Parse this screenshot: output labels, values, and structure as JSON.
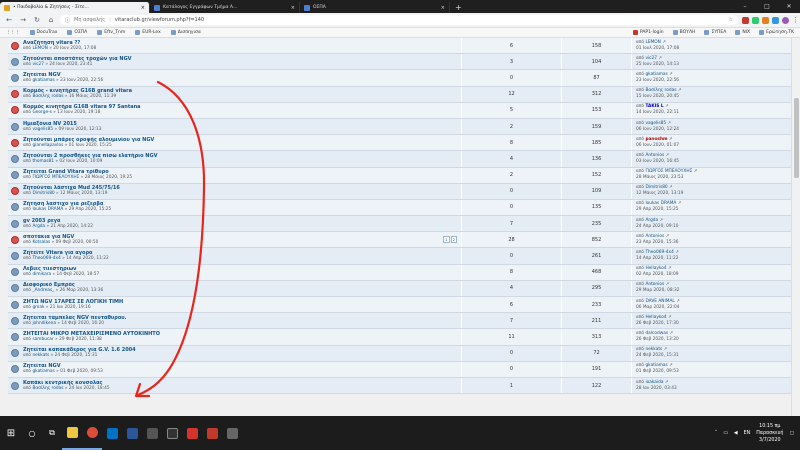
{
  "tabs": [
    {
      "label": "• Παιδοβολία & Ζητήσεις - Σίτε..."
    },
    {
      "label": "Κατάλογος Εγγράφων Τμήμα Α..."
    },
    {
      "label": "ΟΣΠΑ"
    }
  ],
  "address": {
    "security": "Μη ασφαλής",
    "url": "vitaraclub.gr/viewforum.php?f=140"
  },
  "bookmarks": [
    "DocuTrax",
    "ΟΣΠΑ",
    "Eftv_Tnm",
    "EUR-Lex",
    "Δισπηγισα"
  ],
  "bookmarks_right": [
    "PAP1-login",
    "ΒΟΥΛΗ",
    "ΣΥΠΕΑ",
    "NIX",
    "Eρώτηση.TK"
  ],
  "topics": [
    {
      "title": "Αναζήτηση vitara ??",
      "meta_prefix": "από",
      "author": "LEMON",
      "date": "» 20 Ιουν 2020, 17:08",
      "hot": true,
      "replies": "6",
      "views": "158",
      "last_author": "LEMON",
      "last_date": "01 Ιουλ 2020, 17:08"
    },
    {
      "title": "Ζητούνται αποστάτες τροχών για NGV",
      "meta_prefix": "από",
      "author": "vic27",
      "date": "» 24 Ιουν 2020, 23:41",
      "hot": false,
      "replies": "3",
      "views": "104",
      "last_author": "vic27",
      "last_date": "25 Ιουν 2020, 14:13"
    },
    {
      "title": "Ζητείται NGV",
      "meta_prefix": "από",
      "author": "gkatiamas",
      "date": "» 23 Ιουν 2020, 22:56",
      "hot": false,
      "replies": "0",
      "views": "87",
      "last_author": "gkatiamas",
      "last_date": "23 Ιουν 2020, 22:56"
    },
    {
      "title": "Κορμός - κινητήρας G16B grand vitara",
      "meta_prefix": "από",
      "author": "Βασίλης rodas",
      "date": "» 16 Μάιος 2020, 11:39",
      "hot": true,
      "replies": "12",
      "views": "312",
      "last_author": "Βασίλης rodas",
      "last_date": "15 Ιουν 2020, 20:45"
    },
    {
      "title": "Κορμός κινητήρα G16B vitara 97 Santana",
      "meta_prefix": "από",
      "author": "George-s",
      "date": "» 13 Ιουν 2020, 19:18",
      "hot": true,
      "replies": "5",
      "views": "153",
      "last_author": "TAKIS L",
      "last_date": "14 Ιουν 2020, 22:11",
      "last_blue": true
    },
    {
      "title": "Ημιαξόνια NV 2015",
      "meta_prefix": "από",
      "author": "vagelis85",
      "date": "» 09 Ιουν 2020, 12:13",
      "hot": false,
      "replies": "2",
      "views": "159",
      "last_author": "vagelis85",
      "last_date": "06 Ιουν 2020, 12:24"
    },
    {
      "title": "Ζητούνται μπάρες οροφής αλουμινίου για NGV",
      "meta_prefix": "από",
      "author": "gianellapavlos",
      "date": "» 01 Ιουν 2020, 15:25",
      "hot": true,
      "replies": "8",
      "views": "185",
      "last_author": "panoshm",
      "last_date": "06 Ιουν 2020, 01:07",
      "last_red": true
    },
    {
      "title": "Ζητούνται 2 προσθήκες για πίσω ελατήριο NGV",
      "meta_prefix": "από",
      "author": "thomas81",
      "date": "» 02 Ιουν 2020, 10:09",
      "hot": false,
      "replies": "4",
      "views": "136",
      "last_author": "Antonios",
      "last_date": "03 Ιουν 2020, 16:45"
    },
    {
      "title": "Ζητείται Grand Vitara τρίθυρο",
      "meta_prefix": "από",
      "author": "ΓΙΩΡΓΟΣ ΜΠΕΛΟΥΧΗΣ",
      "date": "» 28 Μάιος 2020, 19:25",
      "hot": false,
      "replies": "2",
      "views": "152",
      "last_author": "ΓΙΩΡΓΟΣ ΜΠΕΛΟΥΧΗΣ",
      "last_date": "28 Μάιος 2020, 23:53"
    },
    {
      "title": "Ζητούνται λάστιχα Mud 245/75/16",
      "meta_prefix": "από",
      "author": "Dimitris80",
      "date": "» 12 Μάιος 2020, 13:19",
      "hot": true,
      "replies": "0",
      "views": "109",
      "last_author": "Dimitris80",
      "last_date": "12 Μάιος 2020, 13:19"
    },
    {
      "title": "Ζήτηση λαστιχο για ρεζερβα",
      "meta_prefix": "από",
      "author": "loukas DRAMA",
      "date": "» 29 Απρ 2020, 15:25",
      "hot": false,
      "replies": "0",
      "views": "135",
      "last_author": "loukas DRAMA",
      "last_date": "29 Απρ 2020, 15:25"
    },
    {
      "title": "gv 2003 ρεγα",
      "meta_prefix": "από",
      "author": "Argda",
      "date": "» 21 Απρ 2020, 14:22",
      "hot": false,
      "replies": "7",
      "views": "235",
      "last_author": "Argda",
      "last_date": "24 Απρ 2020, 09:10"
    },
    {
      "title": "σποτακια για NGV",
      "meta_prefix": "από",
      "author": "Kotsalas",
      "date": "» 09 Φεβ 2020, 00:50",
      "hot": true,
      "replies": "28",
      "views": "852",
      "last_author": "Antonios",
      "last_date": "23 Απρ 2020, 15:36",
      "pages": [
        "1",
        "2"
      ]
    },
    {
      "title": "Ζητείτε Vitara για αγορα",
      "meta_prefix": "από",
      "author": "Theo069-4x4",
      "date": "» 14 Απρ 2020, 11:22",
      "hot": false,
      "replies": "0",
      "views": "261",
      "last_author": "Theo069-4x4",
      "last_date": "14 Απρ 2020, 11:22"
    },
    {
      "title": "Λεβιες τιιεστηριων",
      "meta_prefix": "από",
      "author": "dimikara",
      "date": "» 14 Φεβ 2020, 18:57",
      "hot": false,
      "replies": "8",
      "views": "468",
      "last_author": "Hellayko4",
      "last_date": "02 Απρ 2020, 18:09"
    },
    {
      "title": "Διαφορικό Εμπρός",
      "meta_prefix": "από",
      "author": "_Andreas_",
      "date": "» 26 Μαρ 2020, 13:36",
      "hot": false,
      "replies": "4",
      "views": "295",
      "last_author": "Antonios",
      "last_date": "29 Μαρ 2020, 08:32"
    },
    {
      "title": "ΖΗΤΩ NGV 17ΑΡΕΣ ΣΕ ΛΟΓΙΚΗ ΤΙΜΗ",
      "meta_prefix": "από",
      "author": "gmak",
      "date": "» 21 Ιαν 2020, 19:16",
      "hot": false,
      "replies": "6",
      "views": "233",
      "last_author": "DAVE ANIMAL",
      "last_date": "06 Μαρ 2020, 22:04"
    },
    {
      "title": "Ζητειται ταμπελας NGV πενταθυρου.",
      "meta_prefix": "από",
      "author": "johndikena",
      "date": "» 14 Φεβ 2020, 16:20",
      "hot": false,
      "replies": "7",
      "views": "211",
      "last_author": "Hellayko4",
      "last_date": "26 Φεβ 2020, 17:30"
    },
    {
      "title": "ΖΗΤΕΙΤΑΙ ΜΙΚΡΟ ΜΕΤΑΧΕΙΡΙΣΜΕΝΟ ΑΥΤΟΚΙΝΗΤΟ",
      "meta_prefix": "από",
      "author": "sambucar",
      "date": "» 29 Φεβ 2020, 11:38",
      "hot": false,
      "replies": "11",
      "views": "313",
      "last_author": "dalcodwas",
      "last_date": "26 Φεβ 2020, 13:20"
    },
    {
      "title": "Ζητείται καπακάδερος για G.V. 1.6 2004",
      "meta_prefix": "από",
      "author": "nekkats",
      "date": "» 24 Φεβ 2020, 15:31",
      "hot": false,
      "replies": "0",
      "views": "72",
      "last_author": "nekkats",
      "last_date": "24 Φεβ 2020, 15:31"
    },
    {
      "title": "Ζητείται NGV",
      "meta_prefix": "από",
      "author": "gkatiamas",
      "date": "» 01 Φεβ 2020, 09:53",
      "hot": false,
      "replies": "0",
      "views": "191",
      "last_author": "gkatiamas",
      "last_date": "01 Φεβ 2020, 09:53"
    },
    {
      "title": "Καπάκι κεντρικής κονσολας",
      "meta_prefix": "από",
      "author": "Βασίλης rodas",
      "date": "» 24 Ιαν 2020, 18:45",
      "hot": false,
      "replies": "1",
      "views": "122",
      "last_author": "ioakaida",
      "last_date": "28 Ιαν 2020, 03:43"
    }
  ],
  "last_prefix": "από",
  "taskbar": {
    "lang": "EN",
    "time": "10:15 πμ",
    "day": "Παρασκευή",
    "date": "3/7/2020"
  },
  "arrow_color": "#e8251d",
  "accent": "#105289"
}
